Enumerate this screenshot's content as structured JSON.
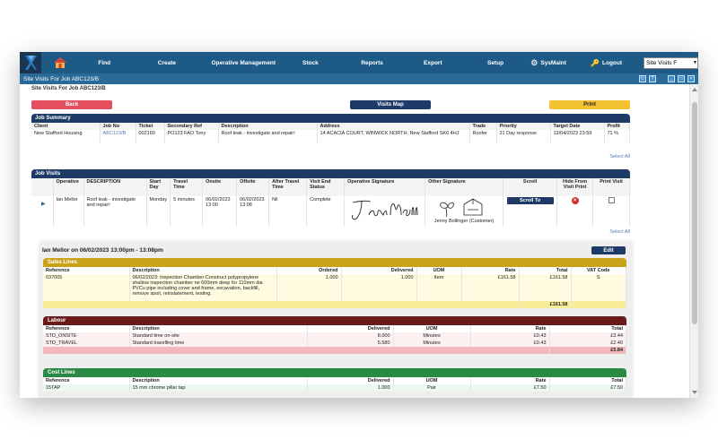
{
  "nav": {
    "items": [
      "Find",
      "Create",
      "Operative Management",
      "Stock",
      "Reports",
      "Export",
      "Setup"
    ],
    "sysmaint": "SysMaint",
    "logout": "Logout",
    "select_value": "Site Visits F"
  },
  "window_title": "Site Visits For Job ABC123/B",
  "page_heading": "Site Visits For Job ABC123/B",
  "buttons": {
    "back": "Back",
    "visits_map": "Visits Map",
    "print": "Print",
    "edit": "Edit",
    "scroll_to": "Scroll To"
  },
  "select_all": "Select All",
  "job_summary": {
    "title": "Job Summary",
    "headers": [
      "Client",
      "Job No",
      "Ticket",
      "Secondary Ref",
      "Description",
      "Address",
      "Trade",
      "Priority",
      "Target Date",
      "Profit"
    ],
    "row": {
      "client": "New Stafford Housing",
      "job_no": "ABC123/B",
      "ticket": "002160",
      "secondary_ref": "PO123 FAO Tony",
      "description": "Roof leak - investigate and repair!",
      "address": "14 ACACIA COURT, WINWICK NORTH, New Stafford SK6 4HJ",
      "trade": "Roofer",
      "priority": "21 Day response",
      "target_date": "13/04/2023 23:59",
      "profit": "71 %"
    }
  },
  "job_visits": {
    "title": "Job Visits",
    "headers": [
      "Operative",
      "DESCRIPTION",
      "Start Day",
      "Travel Time",
      "Onsite",
      "Offsite",
      "After Travel Time",
      "Visit End Status",
      "Operative Signature",
      "Other Signature",
      "Scroll",
      "Hide From Visit Print",
      "Print Visit"
    ],
    "row": {
      "operative": "Ian Mellor",
      "description": "Roof leak - investigate and repair!",
      "start_day": "Monday",
      "travel_time": "5 minutes",
      "onsite": "06/02/2023 13:00",
      "offsite": "06/02/2023 13:08",
      "after_travel": "Nil",
      "end_status": "Complete",
      "other_sig_name": "Jenny Bollinger (Customer)"
    }
  },
  "visit_detail": {
    "title": "Ian Mellor on 06/02/2023 13:00pm - 13:08pm",
    "sales": {
      "title": "Sales Lines",
      "headers": [
        "Reference",
        "Description",
        "Ordered",
        "Delivered",
        "UOM",
        "Rate",
        "Total",
        "VAT Code"
      ],
      "rows": [
        {
          "ref": "037005",
          "desc": "06/02/2023: Inspection Chamber:Construct polypropylene shallow inspection chamber ne 600mm deep for 110mm dia PVCu pipe including cover and frame, excavation, backfill, remove spoil, reinstatement, testing.",
          "ordered": "1.000",
          "delivered": "1.000",
          "uom": "Item",
          "rate": "£161.58",
          "total": "£161.58",
          "vat": "S"
        }
      ],
      "total": "£161.58"
    },
    "labour": {
      "title": "Labour",
      "headers": [
        "Reference",
        "Description",
        "Delivered",
        "UOM",
        "Rate",
        "Total"
      ],
      "rows": [
        {
          "ref": "STD_ONSITE",
          "desc": "Standard time on-site",
          "delivered": "8.000",
          "uom": "Minutes",
          "rate": "£0.43",
          "total": "£3.44"
        },
        {
          "ref": "STD_TRAVEL",
          "desc": "Standard travelling time",
          "delivered": "5.580",
          "uom": "Minutes",
          "rate": "£0.43",
          "total": "£2.40"
        }
      ],
      "total": "£5.84"
    },
    "cost": {
      "title": "Cost Lines",
      "headers": [
        "Reference",
        "Description",
        "Delivered",
        "UOM",
        "Rate",
        "Total"
      ],
      "rows": [
        {
          "ref": "15TAP",
          "desc": "15 mm chrome pillar tap",
          "delivered": "1.000",
          "uom": "Pair",
          "rate": "£7.50",
          "total": "£7.50"
        }
      ]
    }
  },
  "colors": {
    "nav": "#1d5a86",
    "navy": "#1e3a66",
    "back": "#e55060",
    "print": "#f3c232",
    "sales": "#c9a21a",
    "labour": "#6b1a1a",
    "cost": "#2a8a45"
  }
}
